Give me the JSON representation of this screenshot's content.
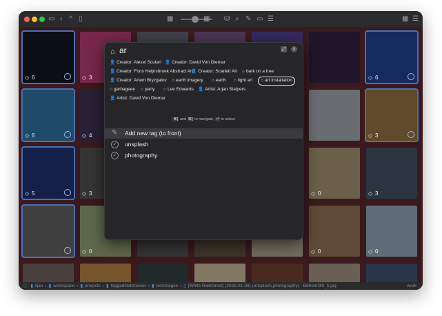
{
  "app": {
    "toolbar": {
      "icons": [
        "sidebar-toggle-icon",
        "chevron-left-icon",
        "chevron-up-icon",
        "bookmark-icon",
        "grid-small-icon",
        "grid-large-icon",
        "database-icon",
        "search-icon",
        "tag-icon",
        "folder-icon",
        "list-icon",
        "layout-icon",
        "menu-icon"
      ],
      "zoom_slider": 0.3
    },
    "colors": {
      "tile_bg": "#3a1a1e",
      "selected_outline": "#4b6fb3",
      "palette_bg": "#262628",
      "highlight_row": "#3b3b3f"
    }
  },
  "palette": {
    "query": "ar",
    "chips": [
      {
        "icon": "person-icon",
        "label": "Creator: Alexei Scutari"
      },
      {
        "icon": "person-icon",
        "label": "Creator: David Von Diemar"
      },
      {
        "icon": "person-icon",
        "label": "Creator: Fons Heijnsbroek Abstract Art"
      },
      {
        "icon": "person-icon",
        "label": "Creator: Scarlett Alt"
      },
      {
        "icon": "tag-icon",
        "label": "bark on a tree"
      },
      {
        "icon": "person-icon",
        "label": "Creator: Artem Bryzgalov"
      },
      {
        "icon": "tag-icon",
        "label": "earth imagery"
      },
      {
        "icon": "tag-icon",
        "label": "earth"
      },
      {
        "icon": "tag-icon",
        "label": "light art"
      },
      {
        "icon": "tag-icon",
        "label": "art installation"
      },
      {
        "icon": "tag-icon",
        "label": "garbageee"
      },
      {
        "icon": "tag-icon",
        "label": "party"
      },
      {
        "icon": "tag-icon",
        "label": "Lee Edwards"
      },
      {
        "icon": "person-icon",
        "label": "Artist: Arjan Stalpers"
      },
      {
        "icon": "person-icon",
        "label": "Artist: David Von Diemar"
      }
    ],
    "hint": {
      "keys1": "⌘[",
      "and": "and",
      "keys2": "⌘]",
      "to_navigate": "to navigate,",
      "key3": "⏎",
      "to_select": "to select"
    },
    "rows": [
      {
        "icon": "add-tag-icon",
        "label": "Add new tag (to front)"
      },
      {
        "icon": "check-circle-icon",
        "label": "unsplash"
      },
      {
        "icon": "check-circle-icon",
        "label": "photography"
      }
    ]
  },
  "tiles": [
    {
      "count": "6"
    },
    {
      "count": "3"
    },
    {
      "count": ""
    },
    {
      "count": ""
    },
    {
      "count": ""
    },
    {
      "count": ""
    },
    {
      "count": "6"
    },
    {
      "count": "6"
    },
    {
      "count": "4"
    },
    {
      "count": ""
    },
    {
      "count": ""
    },
    {
      "count": ""
    },
    {
      "count": ""
    },
    {
      "count": "3"
    },
    {
      "count": "5"
    },
    {
      "count": "3"
    },
    {
      "count": ""
    },
    {
      "count": ""
    },
    {
      "count": ""
    },
    {
      "count": "0"
    },
    {
      "count": "3"
    },
    {
      "count": ""
    },
    {
      "count": "0"
    },
    {
      "count": ""
    },
    {
      "count": ""
    },
    {
      "count": ""
    },
    {
      "count": "0"
    },
    {
      "count": "0"
    },
    {
      "count": ""
    },
    {
      "count": ""
    },
    {
      "count": ""
    },
    {
      "count": ""
    },
    {
      "count": ""
    },
    {
      "count": ""
    },
    {
      "count": ""
    }
  ],
  "statusbar": {
    "items": [
      "iljan",
      "workspace",
      "projects",
      "taggedfilebrowser",
      "testimages",
      "[White Rainforest] (2025-01-09) (unsplash,photography) - Bdhom3Rl_5.jpg"
    ],
    "right": "work"
  }
}
